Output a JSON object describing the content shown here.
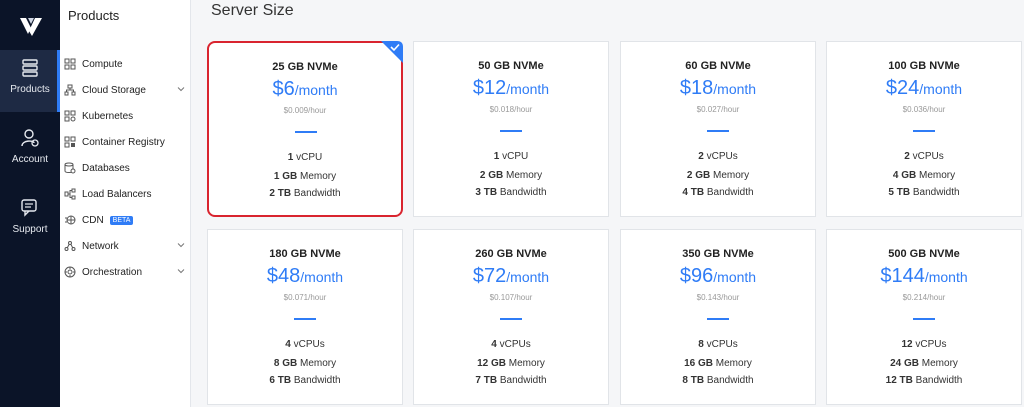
{
  "rail": {
    "items": [
      {
        "label": "Products",
        "icon": "servers-icon"
      },
      {
        "label": "Account",
        "icon": "account-icon"
      },
      {
        "label": "Support",
        "icon": "support-icon"
      }
    ]
  },
  "panel": {
    "title": "Products",
    "items": [
      {
        "label": "Compute"
      },
      {
        "label": "Cloud Storage"
      },
      {
        "label": "Kubernetes"
      },
      {
        "label": "Container Registry"
      },
      {
        "label": "Databases"
      },
      {
        "label": "Load Balancers"
      },
      {
        "label": "CDN",
        "badge": "BETA"
      },
      {
        "label": "Network"
      },
      {
        "label": "Orchestration"
      }
    ]
  },
  "page": {
    "title": "Server Size"
  },
  "plans": [
    {
      "storage": "25 GB NVMe",
      "price": "$6",
      "per": "/month",
      "hourly": "$0.009/hour",
      "cpu_n": "1",
      "cpu_u": "vCPU",
      "mem_n": "1 GB",
      "mem_u": "Memory",
      "bw_n": "2 TB",
      "bw_u": "Bandwidth"
    },
    {
      "storage": "50 GB NVMe",
      "price": "$12",
      "per": "/month",
      "hourly": "$0.018/hour",
      "cpu_n": "1",
      "cpu_u": "vCPU",
      "mem_n": "2 GB",
      "mem_u": "Memory",
      "bw_n": "3 TB",
      "bw_u": "Bandwidth"
    },
    {
      "storage": "60 GB NVMe",
      "price": "$18",
      "per": "/month",
      "hourly": "$0.027/hour",
      "cpu_n": "2",
      "cpu_u": "vCPUs",
      "mem_n": "2 GB",
      "mem_u": "Memory",
      "bw_n": "4 TB",
      "bw_u": "Bandwidth"
    },
    {
      "storage": "100 GB NVMe",
      "price": "$24",
      "per": "/month",
      "hourly": "$0.036/hour",
      "cpu_n": "2",
      "cpu_u": "vCPUs",
      "mem_n": "4 GB",
      "mem_u": "Memory",
      "bw_n": "5 TB",
      "bw_u": "Bandwidth"
    },
    {
      "storage": "180 GB NVMe",
      "price": "$48",
      "per": "/month",
      "hourly": "$0.071/hour",
      "cpu_n": "4",
      "cpu_u": "vCPUs",
      "mem_n": "8 GB",
      "mem_u": "Memory",
      "bw_n": "6 TB",
      "bw_u": "Bandwidth"
    },
    {
      "storage": "260 GB NVMe",
      "price": "$72",
      "per": "/month",
      "hourly": "$0.107/hour",
      "cpu_n": "4",
      "cpu_u": "vCPUs",
      "mem_n": "12 GB",
      "mem_u": "Memory",
      "bw_n": "7 TB",
      "bw_u": "Bandwidth"
    },
    {
      "storage": "350 GB NVMe",
      "price": "$96",
      "per": "/month",
      "hourly": "$0.143/hour",
      "cpu_n": "8",
      "cpu_u": "vCPUs",
      "mem_n": "16 GB",
      "mem_u": "Memory",
      "bw_n": "8 TB",
      "bw_u": "Bandwidth"
    },
    {
      "storage": "500 GB NVMe",
      "price": "$144",
      "per": "/month",
      "hourly": "$0.214/hour",
      "cpu_n": "12",
      "cpu_u": "vCPUs",
      "mem_n": "24 GB",
      "mem_u": "Memory",
      "bw_n": "12 TB",
      "bw_u": "Bandwidth"
    }
  ],
  "colors": {
    "accent": "#2f7cf6",
    "selected_border": "#d9242f",
    "rail_bg": "#0b1428"
  }
}
